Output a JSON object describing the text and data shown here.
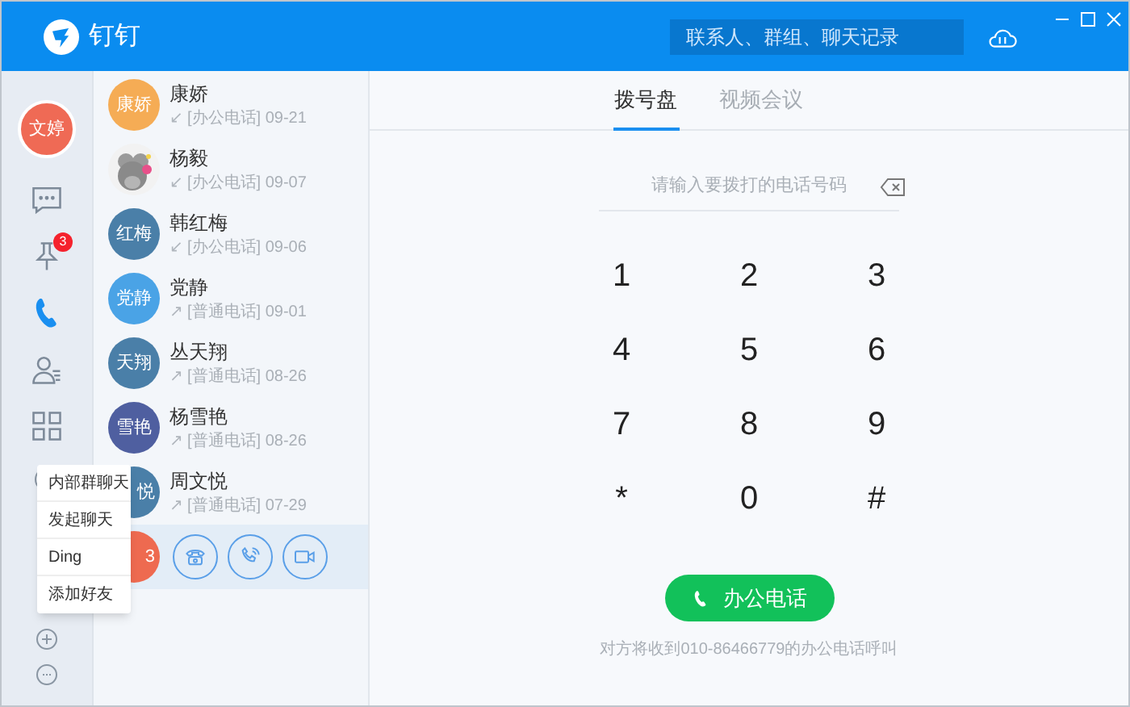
{
  "app": {
    "title": "钉钉",
    "search": {
      "placeholder": "联系人、群组、聊天记录"
    }
  },
  "rail": {
    "user": "文婷",
    "items": [
      {
        "kind": "chat",
        "selected": false
      },
      {
        "kind": "pin",
        "badge": "3",
        "selected": false
      },
      {
        "kind": "phone",
        "selected": true
      },
      {
        "kind": "contacts",
        "selected": false
      },
      {
        "kind": "apps",
        "selected": false
      }
    ]
  },
  "calls": [
    {
      "name": "康娇",
      "avatar": "康娇",
      "color": "#f5ac55",
      "arrow": "↙",
      "detail": "[办公电话] 09-21",
      "selected": false
    },
    {
      "name": "杨毅",
      "kind": "picture",
      "arrow": "↙",
      "detail": "[办公电话] 09-07",
      "selected": false
    },
    {
      "name": "韩红梅",
      "avatar": "红梅",
      "color": "#4a7fa8",
      "arrow": "↙",
      "detail": "[办公电话] 09-06",
      "selected": false
    },
    {
      "name": "党静",
      "avatar": "党静",
      "color": "#4aa3e6",
      "arrow": "↗",
      "detail": "[普通电话] 09-01",
      "selected": false
    },
    {
      "name": "丛天翔",
      "avatar": "天翔",
      "color": "#4a7fa8",
      "arrow": "↗",
      "detail": "[普通电话] 08-26",
      "selected": false
    },
    {
      "name": "杨雪艳",
      "avatar": "雪艳",
      "color": "#4f5fa0",
      "arrow": "↗",
      "detail": "[普通电话] 08-26",
      "selected": false
    },
    {
      "name": "周文悦",
      "avatar": "悦",
      "color": "#4a7fa8",
      "arrow": "↗",
      "detail": "[普通电话] 07-29",
      "covered": true,
      "selected": false
    },
    {
      "avatar": "3",
      "color": "#ee6a50",
      "covered": true,
      "selected": true
    }
  ],
  "menu": [
    "内部群聊天",
    "发起聊天",
    "Ding",
    "添加好友"
  ],
  "tabs": [
    {
      "label": "拨号盘",
      "selected": true
    },
    {
      "label": "视频会议",
      "selected": false
    }
  ],
  "dialer": {
    "placeholder": "请输入要拨打的电话号码",
    "keys": [
      "1",
      "2",
      "3",
      "4",
      "5",
      "6",
      "7",
      "8",
      "9",
      "*",
      "0",
      "#"
    ],
    "call_button": "办公电话",
    "note": "对方将收到010-86466779的办公电话呼叫"
  }
}
